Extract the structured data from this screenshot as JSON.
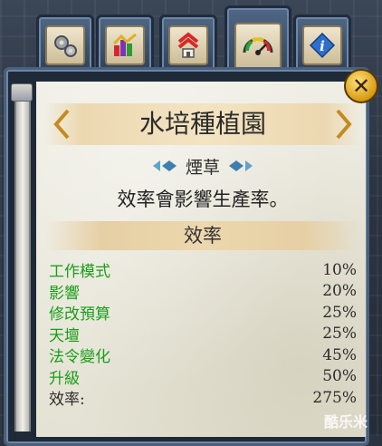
{
  "panel": {
    "title": "水培種植園",
    "crop_name": "煙草",
    "description": "效率會影響生產率。",
    "section_title": "效率",
    "rows": [
      {
        "label": "工作模式",
        "value": "10%"
      },
      {
        "label": "影響",
        "value": "20%"
      },
      {
        "label": "修改預算",
        "value": "25%"
      },
      {
        "label": "天壇",
        "value": "25%"
      },
      {
        "label": "法令變化",
        "value": "45%"
      },
      {
        "label": "升級",
        "value": "50%"
      }
    ],
    "total": {
      "label": "效率:",
      "value": "275%"
    }
  },
  "tabs": [
    {
      "icon": "gears-icon"
    },
    {
      "icon": "bar-chart-icon"
    },
    {
      "icon": "house-upgrade-icon"
    },
    {
      "icon": "gauge-icon",
      "active": true
    },
    {
      "icon": "info-icon"
    }
  ],
  "colors": {
    "bonus_text": "#1a9e19",
    "parchment": "#e9e8db",
    "frame": "#4b607c"
  },
  "watermark": "酷乐米"
}
